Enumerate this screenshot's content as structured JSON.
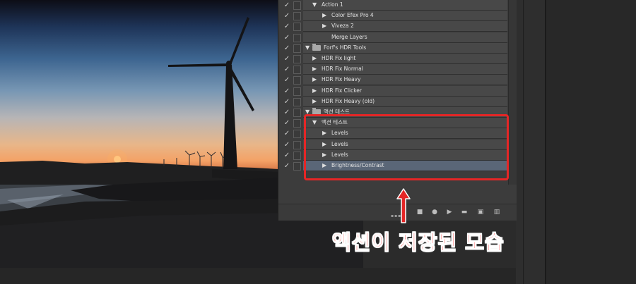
{
  "actions_panel": {
    "rows": [
      {
        "name": "Action 1",
        "depth": 1,
        "expanded": true,
        "checked": true,
        "selected": false
      },
      {
        "name": "Color Efex Pro 4",
        "depth": 2,
        "expanded": false,
        "checked": true,
        "selected": false
      },
      {
        "name": "Viveza 2",
        "depth": 2,
        "expanded": false,
        "checked": true,
        "selected": false
      },
      {
        "name": "Merge Layers",
        "depth": 2,
        "expanded": null,
        "checked": true,
        "selected": false
      },
      {
        "name": "Forf's HDR Tools",
        "depth": 0,
        "expanded": true,
        "checked": true,
        "selected": false,
        "folder": true
      },
      {
        "name": "HDR Fix light",
        "depth": 1,
        "expanded": false,
        "checked": true,
        "selected": false
      },
      {
        "name": "HDR Fix Normal",
        "depth": 1,
        "expanded": false,
        "checked": true,
        "selected": false
      },
      {
        "name": "HDR Fix Heavy",
        "depth": 1,
        "expanded": false,
        "checked": true,
        "selected": false
      },
      {
        "name": "HDR Fix Clicker",
        "depth": 1,
        "expanded": false,
        "checked": true,
        "selected": false
      },
      {
        "name": "HDR Fix Heavy (old)",
        "depth": 1,
        "expanded": false,
        "checked": true,
        "selected": false
      },
      {
        "name": "액션 테스트",
        "depth": 0,
        "expanded": true,
        "checked": true,
        "selected": false,
        "folder": true
      },
      {
        "name": "액션 테스트",
        "depth": 1,
        "expanded": true,
        "checked": true,
        "selected": false
      },
      {
        "name": "Levels",
        "depth": 2,
        "expanded": false,
        "checked": true,
        "selected": false
      },
      {
        "name": "Levels",
        "depth": 2,
        "expanded": false,
        "checked": true,
        "selected": false
      },
      {
        "name": "Levels",
        "depth": 2,
        "expanded": false,
        "checked": true,
        "selected": false
      },
      {
        "name": "Brightness/Contrast",
        "depth": 2,
        "expanded": false,
        "checked": true,
        "selected": true
      }
    ],
    "footer_icons": [
      "stop-icon",
      "record-icon",
      "play-icon",
      "new-set-icon",
      "new-action-icon",
      "delete-icon"
    ]
  },
  "annotation": {
    "caption": "액션이 저장된 모습",
    "highlight_color": "#e52626"
  },
  "colors": {
    "panel_bg": "#3c3c3c",
    "row_bg": "#484848",
    "selected_row_bg": "#5a6677",
    "annotation_red": "#ff3030"
  }
}
